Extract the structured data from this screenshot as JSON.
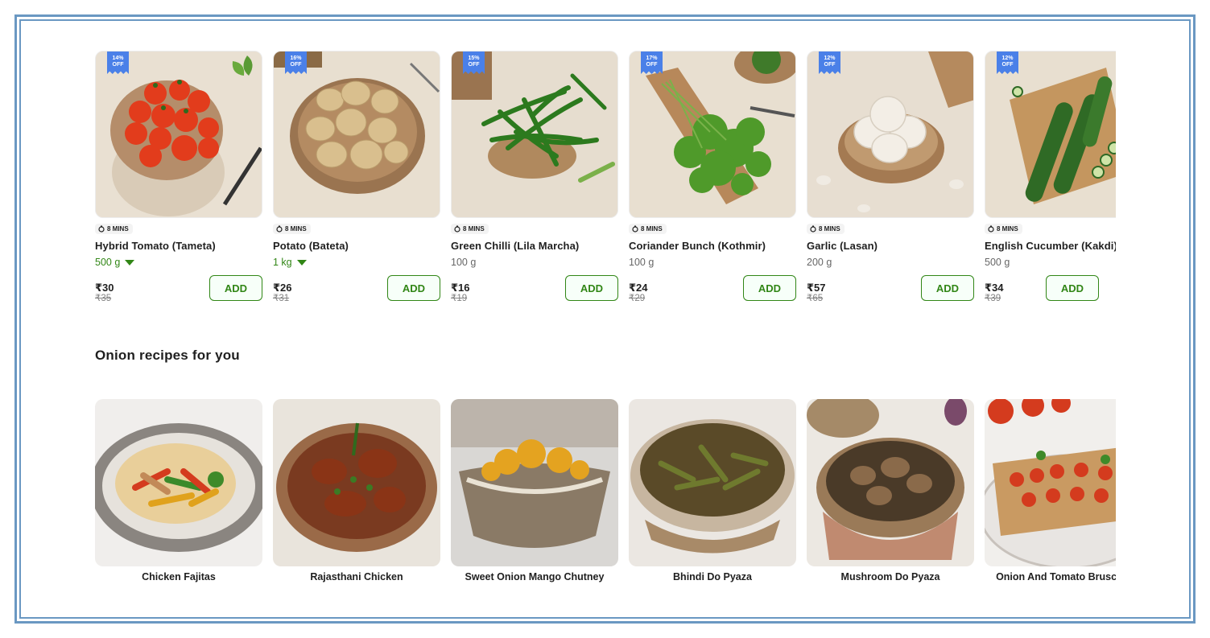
{
  "products": [
    {
      "name": "Hybrid Tomato (Tameta)",
      "qty": "500 g",
      "qty_dropdown": true,
      "price": "₹30",
      "mrp": "₹35",
      "discount_pct": "14%",
      "discount_off": "OFF",
      "eta": "8 MINS",
      "add_label": "ADD",
      "image_icon": "tomato-icon"
    },
    {
      "name": "Potato (Bateta)",
      "qty": "1 kg",
      "qty_dropdown": true,
      "price": "₹26",
      "mrp": "₹31",
      "discount_pct": "16%",
      "discount_off": "OFF",
      "eta": "8 MINS",
      "add_label": "ADD",
      "image_icon": "potato-icon"
    },
    {
      "name": "Green Chilli (Lila Marcha)",
      "qty": "100 g",
      "qty_dropdown": false,
      "price": "₹16",
      "mrp": "₹19",
      "discount_pct": "15%",
      "discount_off": "OFF",
      "eta": "8 MINS",
      "add_label": "ADD",
      "image_icon": "chilli-icon"
    },
    {
      "name": "Coriander Bunch (Kothmir)",
      "qty": "100 g",
      "qty_dropdown": false,
      "price": "₹24",
      "mrp": "₹29",
      "discount_pct": "17%",
      "discount_off": "OFF",
      "eta": "8 MINS",
      "add_label": "ADD",
      "image_icon": "coriander-icon"
    },
    {
      "name": "Garlic (Lasan)",
      "qty": "200 g",
      "qty_dropdown": false,
      "price": "₹57",
      "mrp": "₹65",
      "discount_pct": "12%",
      "discount_off": "OFF",
      "eta": "8 MINS",
      "add_label": "ADD",
      "image_icon": "garlic-icon"
    },
    {
      "name": "English Cucumber (Kakdi)",
      "qty": "500 g",
      "qty_dropdown": false,
      "price": "₹34",
      "mrp": "₹39",
      "discount_pct": "12%",
      "discount_off": "OFF",
      "eta": "8 MINS",
      "add_label": "ADD",
      "image_icon": "cucumber-icon"
    }
  ],
  "recipes_section": {
    "title": "Onion recipes for you",
    "items": [
      {
        "name": "Chicken Fajitas",
        "image_icon": "fajitas-icon"
      },
      {
        "name": "Rajasthani Chicken",
        "image_icon": "chicken-curry-icon"
      },
      {
        "name": "Sweet Onion Mango Chutney",
        "image_icon": "chutney-icon"
      },
      {
        "name": "Bhindi Do Pyaza",
        "image_icon": "bhindi-icon"
      },
      {
        "name": "Mushroom Do Pyaza",
        "image_icon": "mushroom-icon"
      },
      {
        "name": "Onion And Tomato Bruschetta",
        "image_icon": "bruschetta-icon"
      }
    ]
  },
  "colors": {
    "frame": "#6a98c2",
    "accent_green": "#318616",
    "discount_blue": "#4a80e8",
    "image_bg": "#ebe2d4"
  }
}
